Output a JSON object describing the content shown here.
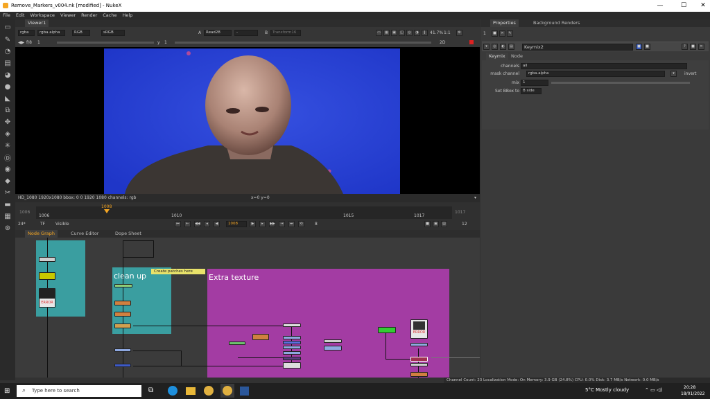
{
  "window": {
    "title": "Remove_Markers_v004.nk [modified] - NukeX",
    "controls": [
      "—",
      "☐",
      "✕"
    ]
  },
  "menu": [
    "File",
    "Edit",
    "Workspace",
    "Viewer",
    "Render",
    "Cache",
    "Help"
  ],
  "viewer": {
    "tab": "Viewer1",
    "channels": "rgba",
    "alpha": "rgba.alpha",
    "display": "RGB",
    "colorspace": "sRGB",
    "input_a_label": "A",
    "input_a": "Read28",
    "input_sep": "-",
    "input_b_label": "B",
    "input_b": "Transform16",
    "fstop": "f/8",
    "frame_step": "1",
    "y_label": "y",
    "y_value": "1",
    "zoom": "41.7%",
    "ratio": "1:1",
    "view_mode": "2D",
    "format_info": "HD_1080 1920x1080  bbox: 0 0 1920 1080 channels: rgb",
    "coords": "x=0 y=0"
  },
  "timeline": {
    "start": "1006",
    "end": "1017",
    "current": "1008",
    "ticks": [
      "1006",
      "1010",
      "1015",
      "1017"
    ],
    "fps": "24*",
    "tf": "TF",
    "visible": "Visible",
    "step": "8",
    "playback_count": "12"
  },
  "properties": {
    "tabs": [
      "Properties",
      "Background Renders"
    ],
    "count": "1",
    "node_name": "Keymix2",
    "subtabs": [
      "Keymix",
      "Node"
    ],
    "channels_label": "channels",
    "channels_value": "all",
    "mask_label": "mask channel",
    "mask_value": "rgba.alpha",
    "invert_label": "invert",
    "mix_label": "mix",
    "mix_value": "1",
    "mix_ticks": [
      "0",
      "0.1",
      "0.2",
      "0.3",
      "0.4",
      "0.5",
      "0.6",
      "0.7",
      "0.8",
      "0.9",
      "1"
    ],
    "bbox_label": "Set BBox to",
    "bbox_value": "B side"
  },
  "bottom_tabs": [
    "Node Graph",
    "Curve Editor",
    "Dope Sheet"
  ],
  "node_graph": {
    "backdrop_cleanup": "clean up",
    "backdrop_extra": "Extra texture",
    "sticky_note": "Create patches here",
    "error_label": "ERROR"
  },
  "status": "Channel Count: 23  Localization Mode: On  Memory: 3.9 GB (24.8%)  CPU: 0.0%  Disk: 3.7 MB/s  Network: 0.0 MB/s",
  "taskbar": {
    "search": "Type here to search",
    "weather": "5°C  Mostly cloudy",
    "time": "20:28",
    "date": "18/01/2022"
  },
  "colors": {
    "cleanup": "#3a9ea0",
    "extra": "#a33ca3",
    "viewer_blue": "#2a44d8",
    "accent": "#f5a623"
  }
}
